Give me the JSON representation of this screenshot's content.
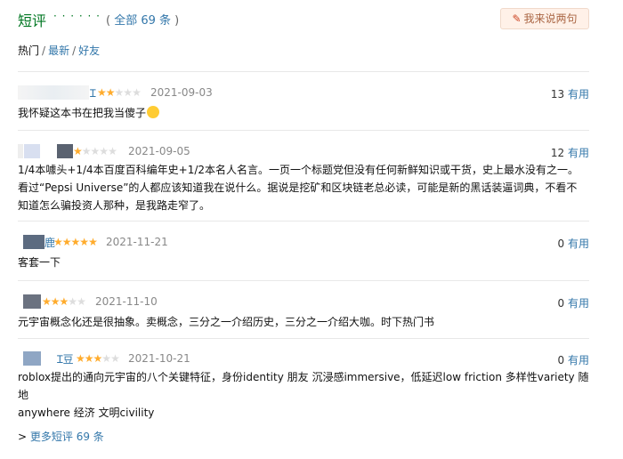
{
  "header": {
    "title": "短评",
    "dots": "· · · · · ·",
    "all_prefix": "( ",
    "all_text": "全部 69 条",
    "all_suffix": " )",
    "write_button": "我来说两句",
    "pencil_icon": "pencil-icon"
  },
  "filters": {
    "hot": "热门",
    "latest": "最新",
    "friends": "好友",
    "separator": "/"
  },
  "comments": [
    {
      "username": "Ɪ",
      "rating": 2,
      "date": "2021-09-03",
      "useful_count": "13",
      "useful_label": "有用",
      "content": "我怀疑这本书在把我当傻子"
    },
    {
      "username": "",
      "rating": 1,
      "date": "2021-09-05",
      "useful_count": "12",
      "useful_label": "有用",
      "content": "1/4本噱头+1/4本百度百科编年史+1/2本名人名言。一页一个标题党但没有任何新鲜知识或干货，史上最水没有之一。\n看过“Pepsi Universe”的人都应该知道我在说什么。据说是挖矿和区块链老总必读，可能是新的黑话装逼词典，不看不\n知道怎么骗投资人那种，是我路走窄了。"
    },
    {
      "username": "鹿",
      "rating": 5,
      "date": "2021-11-21",
      "useful_count": "0",
      "useful_label": "有用",
      "content": "客套一下"
    },
    {
      "username": "",
      "rating": 3,
      "date": "2021-11-10",
      "useful_count": "0",
      "useful_label": "有用",
      "content": "元宇宙概念化还是很抽象。卖概念，三分之一介绍历史，三分之一介绍大咖。时下热门书"
    },
    {
      "username": "Ɪ豆",
      "rating": 3,
      "date": "2021-10-21",
      "useful_count": "0",
      "useful_label": "有用",
      "content": "roblox提出的通向元宇宙的八个关键特征，身份identity 朋友 沉浸感immersive，低延迟low friction 多样性variety 随地\nanywhere 经济 文明civility"
    }
  ],
  "more": {
    "arrow": ">",
    "text": "更多短评 69 条"
  },
  "colors": {
    "accent_green": "#007722",
    "link_blue": "#3377aa",
    "star": "#ffac2d"
  }
}
